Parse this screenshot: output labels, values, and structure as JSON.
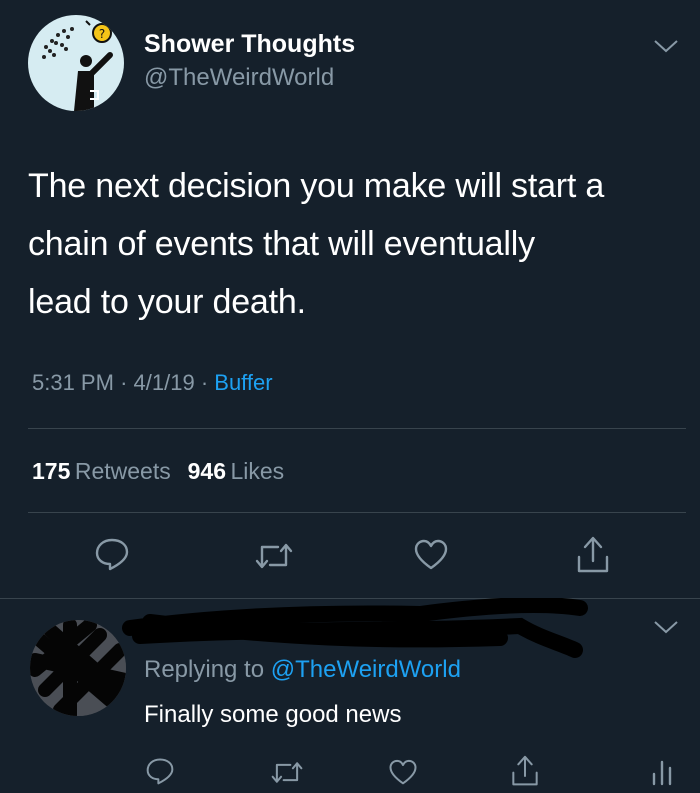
{
  "tweet": {
    "author_name": "Shower Thoughts",
    "author_handle": "@TheWeirdWorld",
    "text_lines": [
      "The next decision you make will start a",
      "chain of events that will eventually",
      "lead to your death."
    ],
    "time": "5:31 PM",
    "date": "4/1/19",
    "separator": "·",
    "source": "Buffer",
    "retweets_count": "175",
    "retweets_label": "Retweets",
    "likes_count": "946",
    "likes_label": "Likes"
  },
  "icons": {
    "reply": "reply-icon",
    "retweet": "retweet-icon",
    "like": "heart-icon",
    "share": "share-icon",
    "more": "chevron-down-icon",
    "analytics": "analytics-icon"
  },
  "reply": {
    "replying_prefix": "Replying to",
    "replying_handle": "@TheWeirdWorld",
    "text": "Finally some good news"
  },
  "colors": {
    "background": "#15202b",
    "accent": "#1da1f2",
    "secondary_text": "#8899a6",
    "divider": "#38444d"
  }
}
